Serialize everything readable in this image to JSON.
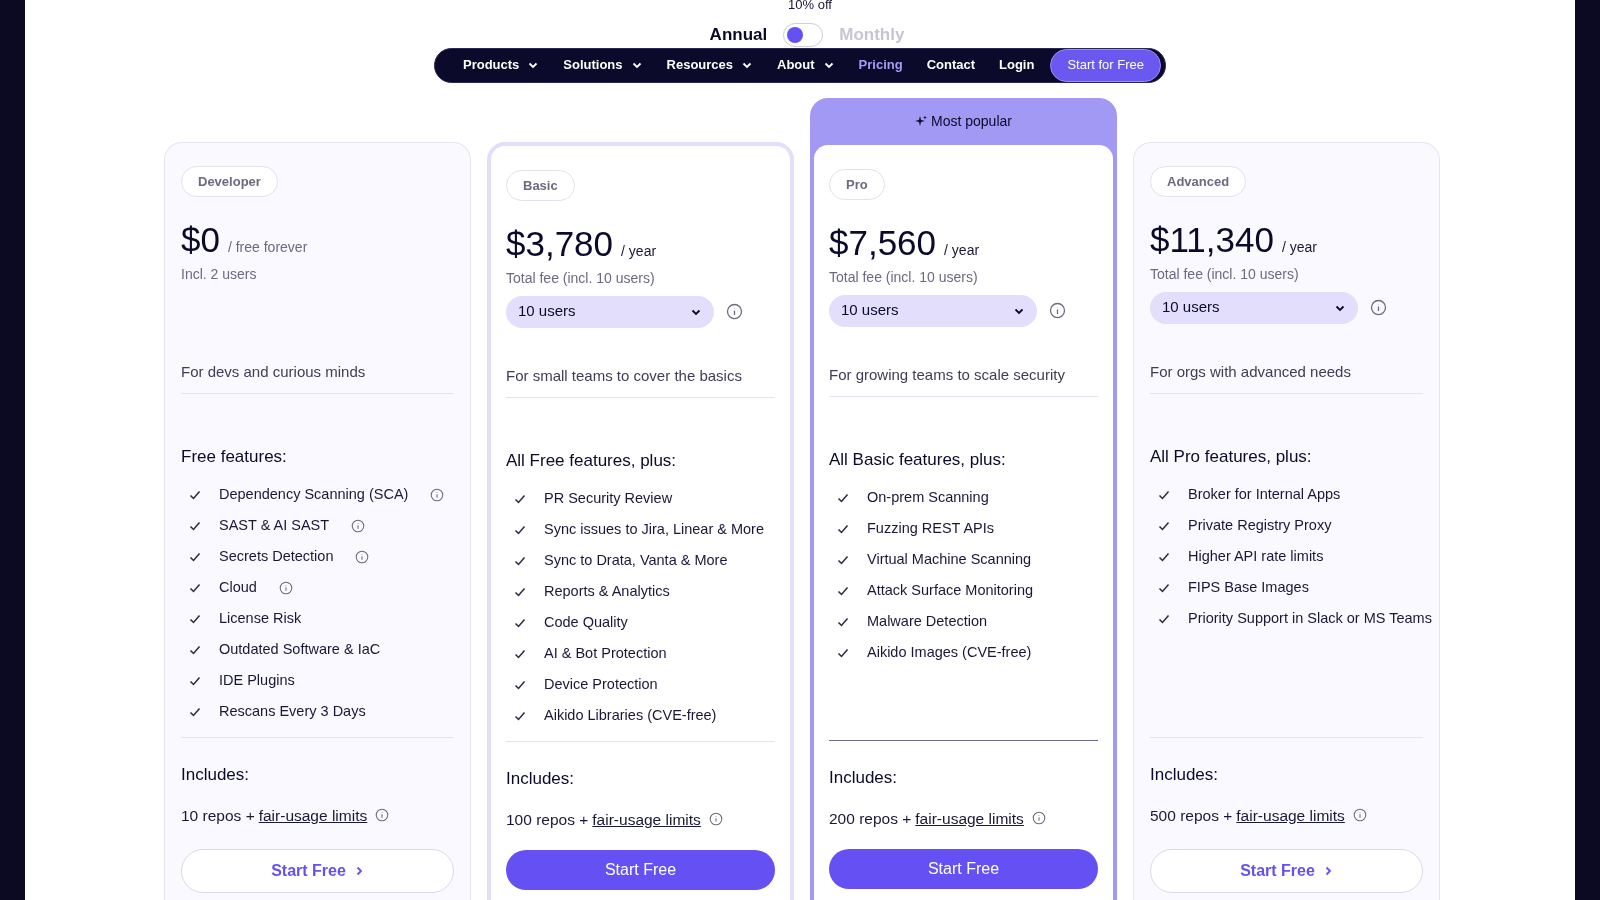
{
  "billing": {
    "discount": "10% off",
    "options": [
      {
        "label": "Annual",
        "selected": true
      },
      {
        "label": "Monthly",
        "selected": false
      }
    ]
  },
  "nav": {
    "items": [
      {
        "label": "Products",
        "dropdown": true,
        "selected": false
      },
      {
        "label": "Solutions",
        "dropdown": true,
        "selected": false
      },
      {
        "label": "Resources",
        "dropdown": true,
        "selected": false
      },
      {
        "label": "About",
        "dropdown": true,
        "selected": false
      },
      {
        "label": "Pricing",
        "dropdown": false,
        "selected": true
      },
      {
        "label": "Contact",
        "dropdown": false,
        "selected": false
      },
      {
        "label": "Login",
        "dropdown": false,
        "selected": false
      }
    ],
    "cta": "Start for Free"
  },
  "plans": [
    {
      "kind": "plain",
      "name": "Developer",
      "price": "$0",
      "period": "/ free forever",
      "subtitle": "Incl. 2 users",
      "tagline": "For devs and curious minds",
      "features_heading": "Free features:",
      "features": [
        {
          "text": "Dependency Scanning (SCA)",
          "info": true
        },
        {
          "text": "SAST & AI SAST",
          "info": true
        },
        {
          "text": "Secrets Detection",
          "info": true
        },
        {
          "text": "Cloud",
          "info": true
        },
        {
          "text": "License Risk"
        },
        {
          "text": "Outdated Software & IaC"
        },
        {
          "text": "IDE Plugins"
        },
        {
          "text": "Rescans Every 3 Days"
        }
      ],
      "includes_heading": "Includes:",
      "includes_text": "10 repos +",
      "includes_link": "fair-usage limits",
      "button": {
        "label": "Start Free",
        "kind": "outline"
      }
    },
    {
      "kind": "outlined",
      "name": "Basic",
      "price": "$3,780",
      "period": "/ year",
      "subtitle": "Total fee (incl. 10 users)",
      "users": "10 users",
      "tagline": "For small teams to cover the basics",
      "features_heading": "All Free features, plus:",
      "features": [
        {
          "text": "PR Security Review"
        },
        {
          "text": "Sync issues to Jira, Linear & More"
        },
        {
          "text": "Sync to Drata, Vanta & More"
        },
        {
          "text": "Reports & Analytics"
        },
        {
          "text": "Code Quality"
        },
        {
          "text": "AI & Bot Protection"
        },
        {
          "text": "Device Protection"
        },
        {
          "text": "Aikido Libraries (CVE-free)"
        }
      ],
      "includes_heading": "Includes:",
      "includes_text": "100 repos +",
      "includes_link": "fair-usage limits",
      "button": {
        "label": "Start Free",
        "kind": "primary"
      }
    },
    {
      "kind": "featured",
      "ribbon": "Most popular",
      "name": "Pro",
      "price": "$7,560",
      "period": "/ year",
      "subtitle": "Total fee (incl. 10 users)",
      "users": "10 users",
      "tagline": "For growing teams to scale security",
      "features_heading": "All Basic features, plus:",
      "features": [
        {
          "text": "On-prem Scanning"
        },
        {
          "text": "Fuzzing REST APIs"
        },
        {
          "text": "Virtual Machine Scanning"
        },
        {
          "text": "Attack Surface Monitoring"
        },
        {
          "text": "Malware Detection"
        },
        {
          "text": "Aikido Images (CVE-free)"
        }
      ],
      "includes_heading": "Includes:",
      "includes_text": "200 repos +",
      "includes_link": "fair-usage limits",
      "button": {
        "label": "Start Free",
        "kind": "primary"
      }
    },
    {
      "kind": "plain",
      "name": "Advanced",
      "price": "$11,340",
      "period": "/ year",
      "subtitle": "Total fee (incl. 10 users)",
      "users": "10 users",
      "tagline": "For orgs with advanced needs",
      "features_heading": "All Pro features, plus:",
      "features": [
        {
          "text": "Broker for Internal Apps"
        },
        {
          "text": "Private Registry Proxy"
        },
        {
          "text": "Higher API rate limits"
        },
        {
          "text": "FIPS Base Images"
        },
        {
          "text": "Priority Support in Slack or MS Teams"
        }
      ],
      "includes_heading": "Includes:",
      "includes_text": "500 repos +",
      "includes_link": "fair-usage limits",
      "button": {
        "label": "Start Free",
        "kind": "outline"
      }
    }
  ]
}
